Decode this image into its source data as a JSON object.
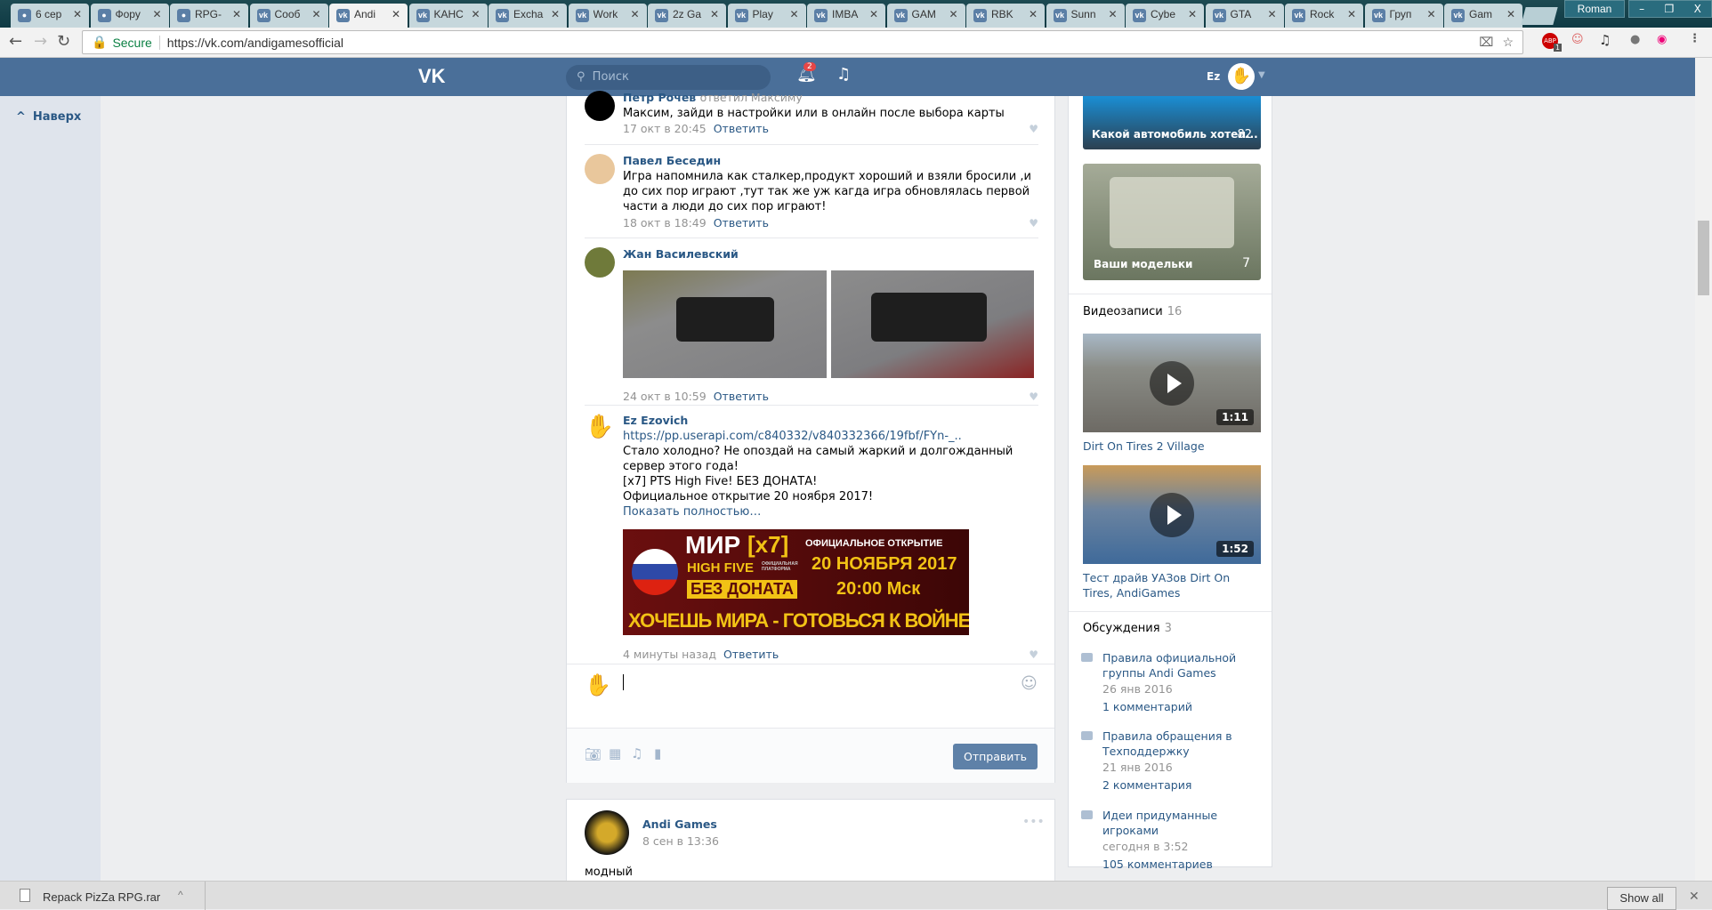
{
  "browser": {
    "tabs": [
      {
        "label": "6 сер"
      },
      {
        "label": "Фору"
      },
      {
        "label": "RPG-"
      },
      {
        "label": "Сооб"
      },
      {
        "label": "Andi",
        "active": true
      },
      {
        "label": "KAHC"
      },
      {
        "label": "Excha"
      },
      {
        "label": "Work"
      },
      {
        "label": "2z Ga"
      },
      {
        "label": "Play"
      },
      {
        "label": "IMBA"
      },
      {
        "label": "GAM"
      },
      {
        "label": "RBK"
      },
      {
        "label": "Sunn"
      },
      {
        "label": "Cybe"
      },
      {
        "label": "GTA"
      },
      {
        "label": "Rock"
      },
      {
        "label": "Груп"
      },
      {
        "label": "Gam"
      }
    ],
    "profile": "Roman",
    "secure": "Secure",
    "url": "https://vk.com/andigamesofficial",
    "abp_badge": "1",
    "download": {
      "file": "Repack PizZa RPG.rar",
      "show_all": "Show all"
    }
  },
  "vk": {
    "search_placeholder": "Поиск",
    "notif_count": "2",
    "user": "Ez",
    "back_to_top": "Наверх"
  },
  "comments": [
    {
      "name": "Петр Рочев",
      "reply_to": "ответил Максиму",
      "text": "Максим, зайди в настройки или в онлайн после выбора карты",
      "date": "17 окт в 20:45",
      "reply": "Ответить"
    },
    {
      "name": "Павел Беседин",
      "text": "Игра напомнила как сталкер,продукт хороший и взяли бросили ,и до сих пор играют ,тут так же уж кагда игра обновлялась первой части а люди до сих пор играют!",
      "date": "18 окт в 18:49",
      "reply": "Ответить"
    },
    {
      "name": "Жан Василевский",
      "date": "24 окт в 10:59",
      "reply": "Ответить"
    },
    {
      "name": "Ez Ezovich",
      "link": "https://pp.userapi.com/c840332/v840332366/19fbf/FYn-_..",
      "lines": [
        "Стало холодно? Не опоздай на самый жаркий и долгожданный сервер этого года!",
        "[x7] PTS High Five! БЕЗ ДОНАТА!",
        "Официальное открытие 20 ноября 2017!"
      ],
      "more": "Показать полностью…",
      "date": "4 минуты назад",
      "reply": "Ответить",
      "banner": {
        "t1": "МИР",
        "t2": "[x7]",
        "t3": "HIGH FIVE",
        "t4": "ОФИЦИАЛЬНАЯ ПЛАТФОРМА",
        "t5": "БЕЗ ДОНАТА",
        "t6": "ОФИЦИАЛЬНОЕ ОТКРЫТИЕ",
        "t7": "20 НОЯБРЯ 2017",
        "t8": "20:00 Мск",
        "t9": "ХОЧЕШЬ МИРА - ГОТОВЬСЯ К ВОЙНЕ"
      }
    }
  ],
  "composer": {
    "send": "Отправить"
  },
  "next_post": {
    "author": "Andi Games",
    "date": "8 сен в 13:36",
    "text": "модный"
  },
  "sidebar": {
    "albums": [
      {
        "title": "Какой автомобиль хотел...",
        "count": "82"
      },
      {
        "title": "Ваши модельки",
        "count": "7"
      }
    ],
    "videos_label": "Видеозаписи",
    "videos_count": "16",
    "videos": [
      {
        "title": "Dirt On Tires 2 Village",
        "duration": "1:11"
      },
      {
        "title": "Тест драйв УАЗов Dirt On Tires, AndiGames",
        "duration": "1:52"
      }
    ],
    "discussions_label": "Обсуждения",
    "discussions_count": "3",
    "discussions": [
      {
        "title": "Правила официальной группы Andi Games",
        "date": "26 янв 2016",
        "comments": "1 комментарий"
      },
      {
        "title": "Правила обращения в Техподдержку",
        "date": "21 янв 2016",
        "comments": "2 комментария"
      },
      {
        "title": "Идеи придуманные игроками",
        "date": "сегодня в 3:52",
        "comments": "105 комментариев"
      }
    ]
  }
}
